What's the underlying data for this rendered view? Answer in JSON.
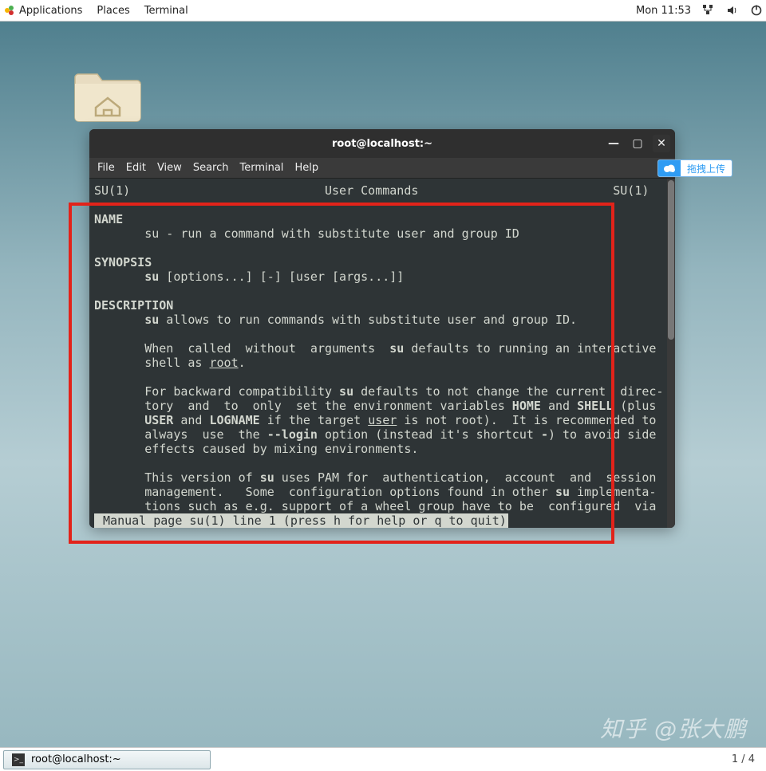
{
  "top_panel": {
    "menus": {
      "applications": "Applications",
      "places": "Places",
      "terminal": "Terminal"
    },
    "clock": "Mon 11:53"
  },
  "terminal": {
    "title": "root@localhost:~",
    "menubar": {
      "file": "File",
      "edit": "Edit",
      "view": "View",
      "search": "Search",
      "terminal": "Terminal",
      "help": "Help"
    },
    "header_left": "SU(1)",
    "header_center": "User Commands",
    "header_right": "SU(1)",
    "sec_name": "NAME",
    "name_line": "       su - run a command with substitute user and group ID",
    "sec_synopsis": "SYNOPSIS",
    "syn_cmd": "su",
    "syn_rest": " [options...] [-] [user [args...]]",
    "sec_description": "DESCRIPTION",
    "d1_su": "su",
    "d1_rest": " allows to run commands with substitute user and group ID.",
    "d2_pre": "       When  called  without  arguments  ",
    "d2_su": "su",
    "d2_post": " defaults to running an interactive",
    "d3_pre": "       shell as ",
    "d3_root": "root",
    "d3_post": ".",
    "d4_pre": "       For backward compatibility ",
    "d4_su": "su",
    "d4_post": " defaults to not change the current  direc-",
    "d5_pre": "       tory  and  to  only  set the environment variables ",
    "d5_home": "HOME",
    "d5_and1": " and ",
    "d5_shell": "SHELL",
    "d5_post": " (plus",
    "d6_user": "USER",
    "d6_and": " and ",
    "d6_logname": "LOGNAME",
    "d6_mid": " if the target ",
    "d6_usr": "user",
    "d6_post": " is not root).  It is recommended to",
    "d7_pre": "       always  use  the ",
    "d7_login": "--login",
    "d7_mid": " option (instead it's shortcut ",
    "d7_dash": "-",
    "d7_post": ") to avoid side",
    "d8": "       effects caused by mixing environments.",
    "d9_pre": "       This version of ",
    "d9_su": "su",
    "d9_post": " uses PAM for  authentication,  account  and  session",
    "d10_pre": "       management.   Some  configuration options found in other ",
    "d10_su": "su",
    "d10_post": " implementa-",
    "d11": "       tions such as e.g. support of a wheel group have to be  configured  via",
    "status": " Manual page su(1) line 1 (press h for help or q to quit)"
  },
  "cloud": {
    "label": "拖拽上传"
  },
  "watermark": "知乎 @张大鹏",
  "taskbar": {
    "task1": "root@localhost:~",
    "pager": "1 / 4"
  }
}
